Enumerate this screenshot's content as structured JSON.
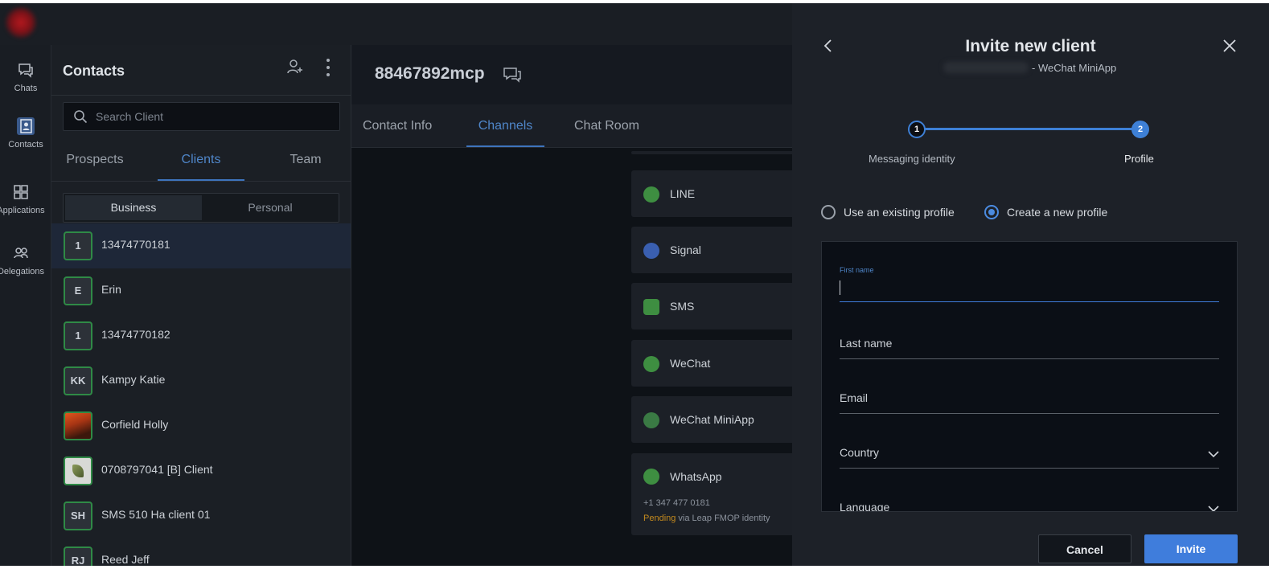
{
  "rail": {
    "items": [
      {
        "label": "Chats",
        "icon": "chat-icon"
      },
      {
        "label": "Contacts",
        "icon": "contacts-icon",
        "active": true
      },
      {
        "label": "Applications",
        "icon": "applications-icon"
      },
      {
        "label": "Delegations",
        "icon": "delegations-icon"
      }
    ]
  },
  "contacts": {
    "title": "Contacts",
    "search_placeholder": "Search Client",
    "tabs": [
      "Prospects",
      "Clients",
      "Team"
    ],
    "active_tab": "Clients",
    "segment": [
      "Business",
      "Personal"
    ],
    "list": [
      {
        "initials": "1",
        "name": "13474770181",
        "selected": true
      },
      {
        "initials": "E",
        "name": "Erin"
      },
      {
        "initials": "1",
        "name": "13474770182"
      },
      {
        "initials": "KK",
        "name": "Kampy Katie"
      },
      {
        "initials": "",
        "name": "Corfield Holly",
        "image": true
      },
      {
        "initials": "",
        "name": "0708797041 [B] Client",
        "image": true
      },
      {
        "initials": "SH",
        "name": "SMS 510 Ha client 01"
      },
      {
        "initials": "RJ",
        "name": "Reed Jeff"
      }
    ]
  },
  "middle": {
    "title": "88467892mcp",
    "tabs": [
      "Contact Info",
      "Channels",
      "Chat Room"
    ],
    "active_tab": "Channels",
    "channels": [
      {
        "name": "LINE",
        "icon": "line-icon"
      },
      {
        "name": "Signal",
        "icon": "signal-icon"
      },
      {
        "name": "SMS",
        "icon": "sms-icon"
      },
      {
        "name": "WeChat",
        "icon": "wechat-icon"
      },
      {
        "name": "WeChat MiniApp",
        "icon": "wechat-miniapp-icon"
      },
      {
        "name": "WhatsApp",
        "icon": "whatsapp-icon",
        "phone": "+1 347 477 0181",
        "status": "Pending",
        "status_suffix": " via Leap FMOP identity"
      }
    ]
  },
  "dialog": {
    "title": "Invite new client",
    "subtitle": "- WeChat MiniApp",
    "steps": [
      {
        "number": "1",
        "label": "Messaging identity"
      },
      {
        "number": "2",
        "label": "Profile"
      }
    ],
    "radio_existing": "Use an existing profile",
    "radio_new": "Create a new profile",
    "fields": {
      "first_name": "First name",
      "last_name": "Last name",
      "email": "Email",
      "country": "Country",
      "language": "Language"
    },
    "cancel": "Cancel",
    "invite": "Invite"
  },
  "colors": {
    "accent": "#3f7ddc",
    "active_tab": "#4f86c9",
    "avatar_border": "#2f8a46",
    "pending": "#c48a1e",
    "background": "#0f1318"
  }
}
